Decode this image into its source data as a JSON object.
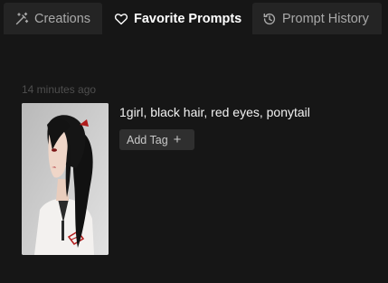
{
  "tabs": {
    "creations": {
      "label": "Creations",
      "icon": "magic-wand-icon"
    },
    "favorites": {
      "label": "Favorite Prompts",
      "icon": "heart-icon",
      "active": true
    },
    "history": {
      "label": "Prompt History",
      "icon": "history-icon"
    }
  },
  "favorite": {
    "timestamp": "14 minutes ago",
    "prompt": "1girl, black hair, red eyes, ponytail",
    "add_tag_label": "Add Tag",
    "add_tag_icon": "plus-icon",
    "image_alt": "generated image of a girl with black ponytail"
  },
  "colors": {
    "background": "#161616",
    "tab_inactive": "#242424",
    "button_bg": "#2f2f2f"
  }
}
